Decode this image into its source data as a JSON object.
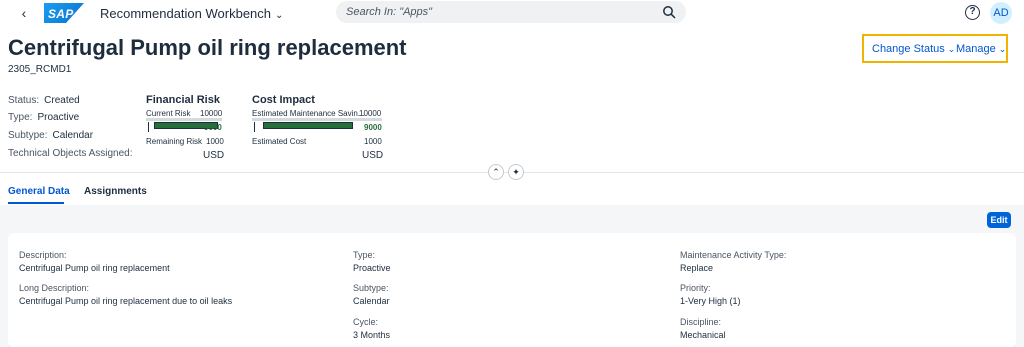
{
  "shell": {
    "app_title": "Recommendation Workbench",
    "logo_text": "SAP",
    "search_placeholder": "Search In: \"Apps\"",
    "avatar_initials": "AD",
    "help_glyph": "?"
  },
  "header": {
    "title": "Centrifugal Pump oil ring replacement",
    "subtitle": "2305_RCMD1",
    "actions": {
      "change_status": "Change Status",
      "manage": "Manage"
    }
  },
  "attributes": [
    {
      "key": "Status:",
      "value": "Created"
    },
    {
      "key": "Type:",
      "value": "Proactive"
    },
    {
      "key": "Subtype:",
      "value": "Calendar"
    },
    {
      "key": "Technical Objects Assigned:",
      "value": ""
    }
  ],
  "financial_risk": {
    "title": "Financial Risk",
    "top_label": "Current Risk",
    "top_value": "10000",
    "mid_value": "9000",
    "bottom_label": "Remaining Risk",
    "bottom_value": "1000",
    "currency": "USD",
    "fill_fraction": 0.9,
    "marker_fraction": 0.1
  },
  "cost_impact": {
    "title": "Cost Impact",
    "top_label": "Estimated Maintenance Savin...",
    "top_value": "10000",
    "mid_value": "9000",
    "bottom_label": "Estimated Cost",
    "bottom_value": "1000",
    "currency": "USD",
    "fill_fraction": 0.9,
    "marker_fraction": 0.1
  },
  "tabs": [
    {
      "label": "General Data",
      "active": true
    },
    {
      "label": "Assignments",
      "active": false
    }
  ],
  "edit_label": "Edit",
  "fields": {
    "col1": [
      {
        "label": "Description:",
        "value": "Centrifugal Pump oil ring replacement"
      },
      {
        "label": "Long Description:",
        "value": "Centrifugal Pump oil ring replacement due to oil leaks"
      }
    ],
    "col2": [
      {
        "label": "Type:",
        "value": "Proactive"
      },
      {
        "label": "Subtype:",
        "value": "Calendar"
      },
      {
        "label": "Cycle:",
        "value": "3 Months"
      }
    ],
    "col3": [
      {
        "label": "Maintenance Activity Type:",
        "value": "Replace"
      },
      {
        "label": "Priority:",
        "value": "1-Very High (1)"
      },
      {
        "label": "Discipline:",
        "value": "Mechanical"
      }
    ]
  },
  "colors": {
    "brand_blue": "#0057d2",
    "positive_green": "#256f3a",
    "highlight": "#f0b400"
  }
}
